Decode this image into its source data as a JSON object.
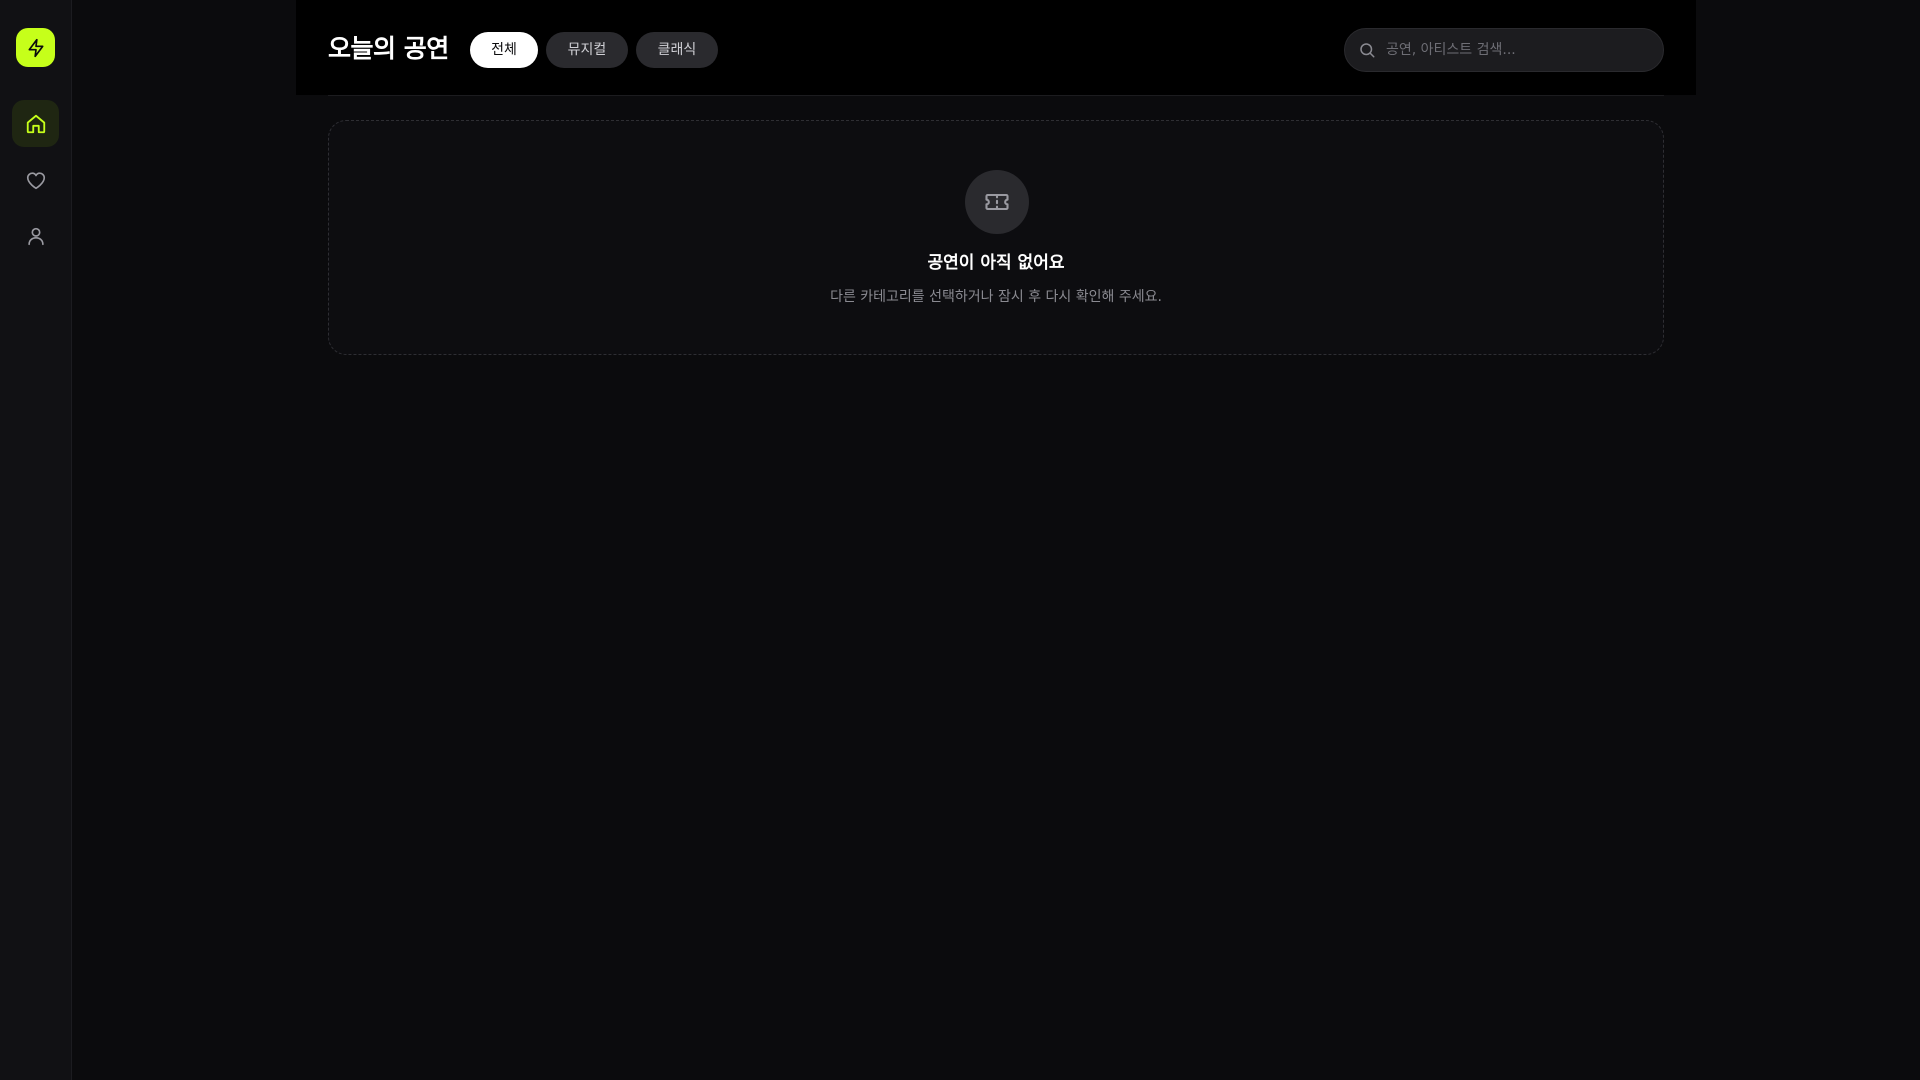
{
  "colors": {
    "accent": "#c6ff1a",
    "background": "#0b0b0d",
    "sidebar": "#111114",
    "header": "#000000"
  },
  "sidebar": {
    "logo_icon": "lightning-icon",
    "items": [
      {
        "icon": "home-icon",
        "active": true
      },
      {
        "icon": "heart-icon",
        "active": false
      },
      {
        "icon": "user-icon",
        "active": false
      }
    ]
  },
  "header": {
    "title": "오늘의 공연",
    "tabs": [
      {
        "label": "전체",
        "selected": true
      },
      {
        "label": "뮤지컬",
        "selected": false
      },
      {
        "label": "클래식",
        "selected": false
      }
    ],
    "search": {
      "icon": "search-icon",
      "placeholder": "공연, 아티스트 검색...",
      "value": ""
    }
  },
  "empty_state": {
    "icon": "ticket-icon",
    "title": "공연이 아직 없어요",
    "description": "다른 카테고리를 선택하거나 잠시 후 다시 확인해 주세요."
  }
}
